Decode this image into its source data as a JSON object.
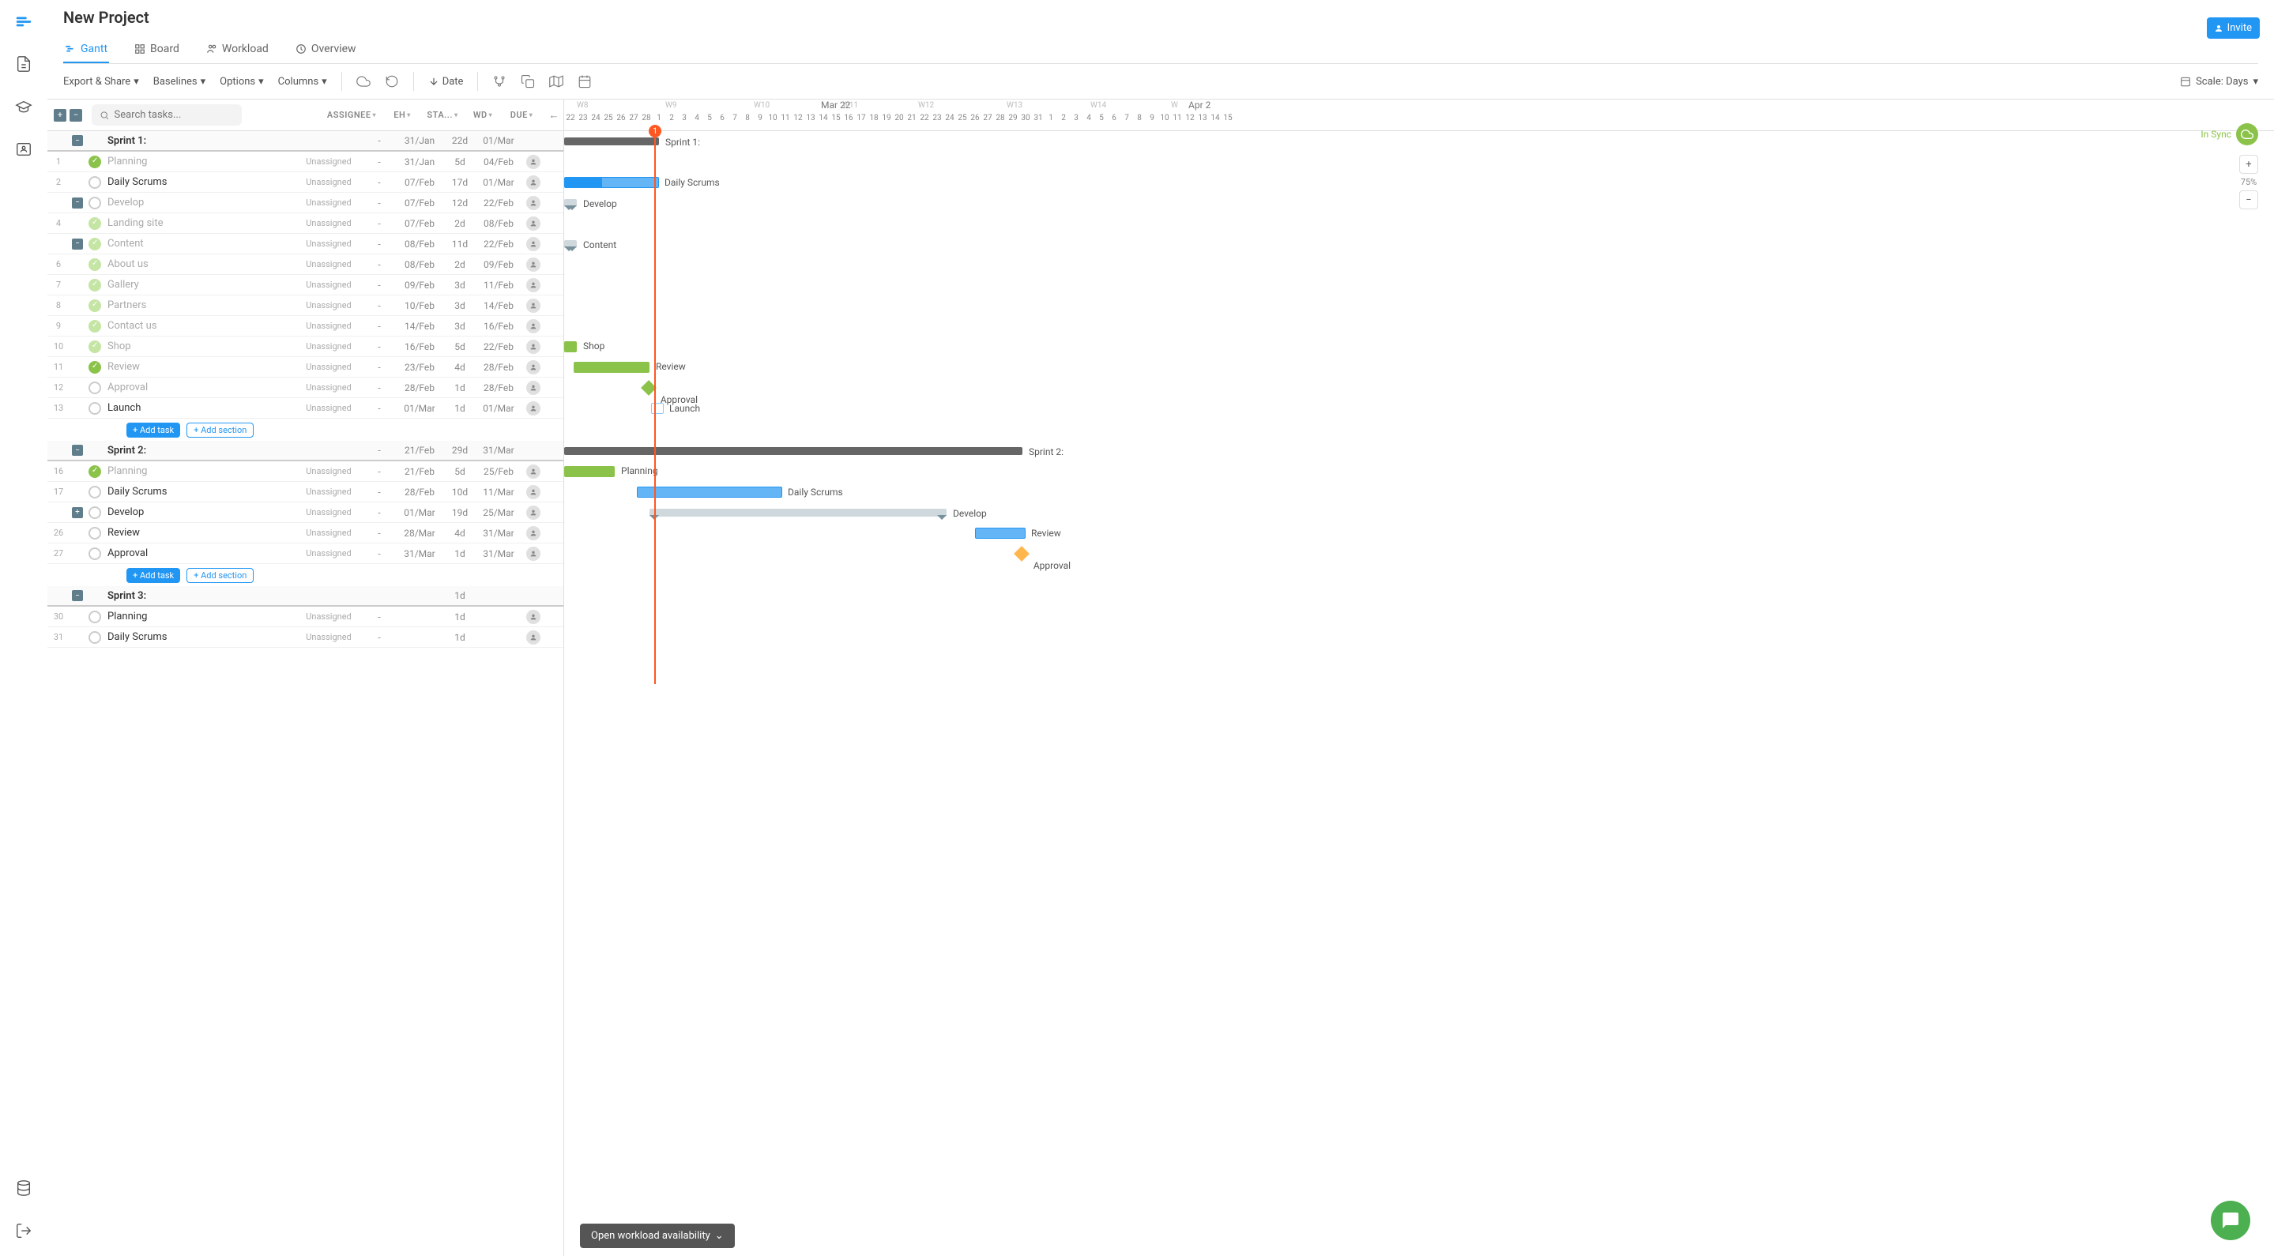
{
  "project": {
    "title": "New Project"
  },
  "tabs": {
    "gantt": "Gantt",
    "board": "Board",
    "workload": "Workload",
    "overview": "Overview"
  },
  "buttons": {
    "invite": "Invite",
    "addTask": "Add task",
    "addSection": "Add section",
    "workload": "Open workload availability"
  },
  "search": {
    "placeholder": "Search tasks..."
  },
  "toolbar": {
    "export": "Export & Share",
    "baselines": "Baselines",
    "options": "Options",
    "columns": "Columns",
    "date": "Date",
    "scale": "Scale: Days"
  },
  "columns": {
    "assignee": "ASSIGNEE",
    "eh": "EH",
    "start": "STA...",
    "wd": "WD",
    "due": "DUE"
  },
  "sync": {
    "label": "In Sync"
  },
  "zoom": {
    "percent": "75%"
  },
  "timeline": {
    "month": "Mar 22",
    "month2": "Apr 2",
    "weeks": [
      "W8",
      "W9",
      "W10",
      "W11",
      "W12",
      "W13",
      "W14",
      "W"
    ],
    "days": [
      "22",
      "23",
      "24",
      "25",
      "26",
      "27",
      "28",
      "1",
      "2",
      "3",
      "4",
      "5",
      "6",
      "7",
      "8",
      "9",
      "10",
      "11",
      "12",
      "13",
      "14",
      "15",
      "16",
      "17",
      "18",
      "19",
      "20",
      "21",
      "22",
      "23",
      "24",
      "25",
      "26",
      "27",
      "28",
      "29",
      "30",
      "31",
      "1",
      "2",
      "3",
      "4",
      "5",
      "6",
      "7",
      "8",
      "9",
      "10",
      "11",
      "12",
      "13",
      "14",
      "15"
    ],
    "today": "1"
  },
  "rows": [
    {
      "type": "section",
      "collapse": "-",
      "name": "Sprint 1:",
      "eh": "-",
      "st": "31/Jan",
      "wd": "22d",
      "du": "01/Mar",
      "barType": "section",
      "barLeft": 0,
      "barW": 120,
      "label": "Sprint 1:"
    },
    {
      "type": "task",
      "num": "1",
      "done": true,
      "name": "Planning",
      "dim": true,
      "ass": "Unassigned",
      "eh": "-",
      "st": "31/Jan",
      "wd": "5d",
      "du": "04/Feb",
      "av": true
    },
    {
      "type": "task",
      "num": "2",
      "name": "Daily Scrums",
      "ass": "Unassigned",
      "eh": "-",
      "st": "07/Feb",
      "wd": "17d",
      "du": "01/Mar",
      "av": true,
      "barType": "blue-prog",
      "barLeft": 0,
      "barW": 120,
      "label": "Daily Scrums"
    },
    {
      "type": "task",
      "num": "",
      "collapse": "-",
      "name": "Develop",
      "dim": true,
      "ass": "Unassigned",
      "eh": "-",
      "st": "07/Feb",
      "wd": "12d",
      "du": "22/Feb",
      "av": true,
      "barType": "summary-ghost",
      "barLeft": 0,
      "barW": 16,
      "label": "Develop"
    },
    {
      "type": "task",
      "num": "4",
      "done": "light",
      "indent": 1,
      "name": "Landing site",
      "dim": true,
      "ass": "Unassigned",
      "eh": "-",
      "st": "07/Feb",
      "wd": "2d",
      "du": "08/Feb",
      "av": true
    },
    {
      "type": "task",
      "num": "",
      "collapse": "-",
      "done": "light",
      "indent": 1,
      "name": "Content",
      "dim": true,
      "ass": "Unassigned",
      "eh": "-",
      "st": "08/Feb",
      "wd": "11d",
      "du": "22/Feb",
      "av": true,
      "barType": "summary-ghost",
      "barLeft": 0,
      "barW": 16,
      "label": "Content"
    },
    {
      "type": "task",
      "num": "6",
      "done": "light",
      "indent": 2,
      "name": "About us",
      "dim": true,
      "ass": "Unassigned",
      "eh": "-",
      "st": "08/Feb",
      "wd": "2d",
      "du": "09/Feb",
      "av": true
    },
    {
      "type": "task",
      "num": "7",
      "done": "light",
      "indent": 2,
      "name": "Gallery",
      "dim": true,
      "ass": "Unassigned",
      "eh": "-",
      "st": "09/Feb",
      "wd": "3d",
      "du": "11/Feb",
      "av": true
    },
    {
      "type": "task",
      "num": "8",
      "done": "light",
      "indent": 2,
      "name": "Partners",
      "dim": true,
      "ass": "Unassigned",
      "eh": "-",
      "st": "10/Feb",
      "wd": "3d",
      "du": "14/Feb",
      "av": true
    },
    {
      "type": "task",
      "num": "9",
      "done": "light",
      "indent": 2,
      "name": "Contact us",
      "dim": true,
      "ass": "Unassigned",
      "eh": "-",
      "st": "14/Feb",
      "wd": "3d",
      "du": "16/Feb",
      "av": true
    },
    {
      "type": "task",
      "num": "10",
      "done": "light",
      "indent": 2,
      "name": "Shop",
      "dim": true,
      "ass": "Unassigned",
      "eh": "-",
      "st": "16/Feb",
      "wd": "5d",
      "du": "22/Feb",
      "av": true,
      "barType": "green",
      "barLeft": 0,
      "barW": 16,
      "label": "Shop"
    },
    {
      "type": "task",
      "num": "11",
      "done": true,
      "name": "Review",
      "dim": true,
      "ass": "Unassigned",
      "eh": "-",
      "st": "23/Feb",
      "wd": "4d",
      "du": "28/Feb",
      "av": true,
      "barType": "green",
      "barLeft": 12,
      "barW": 96,
      "label": "Review"
    },
    {
      "type": "task",
      "num": "12",
      "name": "Approval",
      "dim": true,
      "ass": "Unassigned",
      "eh": "-",
      "st": "28/Feb",
      "wd": "1d",
      "du": "28/Feb",
      "av": true,
      "barType": "diamond-green",
      "barLeft": 100,
      "label": "Approval"
    },
    {
      "type": "task",
      "num": "13",
      "name": "Launch",
      "ass": "Unassigned",
      "eh": "-",
      "st": "01/Mar",
      "wd": "1d",
      "du": "01/Mar",
      "av": true,
      "barType": "outline",
      "barLeft": 110,
      "barW": 16,
      "label": "Launch"
    },
    {
      "type": "add"
    },
    {
      "type": "section",
      "collapse": "-",
      "name": "Sprint 2:",
      "eh": "-",
      "st": "21/Feb",
      "wd": "29d",
      "du": "31/Mar",
      "barType": "section",
      "barLeft": 0,
      "barW": 580,
      "label": "Sprint 2:"
    },
    {
      "type": "task",
      "num": "16",
      "done": true,
      "name": "Planning",
      "dim": true,
      "ass": "Unassigned",
      "eh": "-",
      "st": "21/Feb",
      "wd": "5d",
      "du": "25/Feb",
      "av": true,
      "barType": "green",
      "barLeft": 0,
      "barW": 64,
      "label": "Planning"
    },
    {
      "type": "task",
      "num": "17",
      "name": "Daily Scrums",
      "ass": "Unassigned",
      "eh": "-",
      "st": "28/Feb",
      "wd": "10d",
      "du": "11/Mar",
      "av": true,
      "barType": "blue",
      "barLeft": 92,
      "barW": 184,
      "label": "Daily Scrums"
    },
    {
      "type": "task",
      "num": "",
      "collapse": "+",
      "name": "Develop",
      "ass": "Unassigned",
      "eh": "-",
      "st": "01/Mar",
      "wd": "19d",
      "du": "25/Mar",
      "av": true,
      "barType": "summary",
      "barLeft": 108,
      "barW": 376,
      "label": "Develop"
    },
    {
      "type": "task",
      "num": "26",
      "name": "Review",
      "ass": "Unassigned",
      "eh": "-",
      "st": "28/Mar",
      "wd": "4d",
      "du": "31/Mar",
      "av": true,
      "barType": "blue",
      "barLeft": 520,
      "barW": 64,
      "label": "Review"
    },
    {
      "type": "task",
      "num": "27",
      "name": "Approval",
      "ass": "Unassigned",
      "eh": "-",
      "st": "31/Mar",
      "wd": "1d",
      "du": "31/Mar",
      "av": true,
      "barType": "diamond-yellow",
      "barLeft": 572,
      "label": "Approval"
    },
    {
      "type": "add"
    },
    {
      "type": "section",
      "collapse": "-",
      "name": "Sprint 3:",
      "wd": "1d"
    },
    {
      "type": "task",
      "num": "30",
      "name": "Planning",
      "ass": "Unassigned",
      "eh": "-",
      "wd": "1d",
      "av": true
    },
    {
      "type": "task",
      "num": "31",
      "name": "Daily Scrums",
      "ass": "Unassigned",
      "eh": "-",
      "wd": "1d",
      "av": true
    }
  ]
}
